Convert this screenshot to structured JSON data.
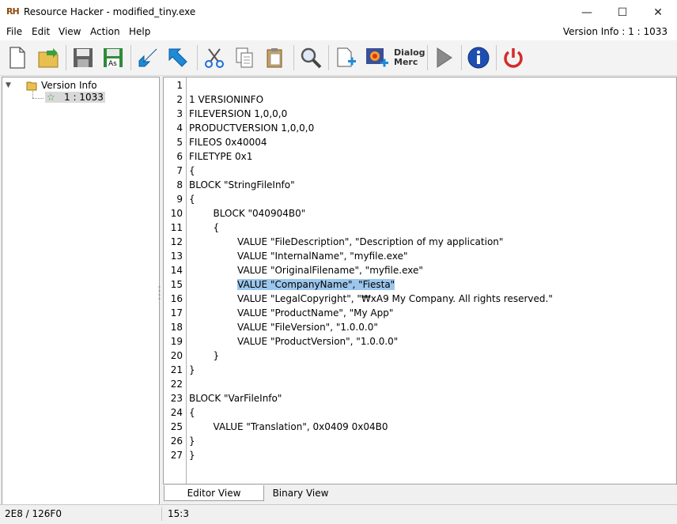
{
  "window": {
    "title": "Resource Hacker - modified_tiny.exe",
    "logo_text": "RH",
    "minimize_glyph": "—",
    "maximize_glyph": "☐",
    "close_glyph": "✕"
  },
  "menu": {
    "items": [
      "File",
      "Edit",
      "View",
      "Action",
      "Help"
    ],
    "right_label": "Version Info : 1 : 1033"
  },
  "toolbar": {
    "dialog_menu_line1": "Dialog",
    "dialog_menu_line2": "Merc"
  },
  "tree": {
    "root_label": "Version Info",
    "child_label": "1 : 1033"
  },
  "editor": {
    "lines": [
      "",
      "1 VERSIONINFO",
      "FILEVERSION 1,0,0,0",
      "PRODUCTVERSION 1,0,0,0",
      "FILEOS 0x40004",
      "FILETYPE 0x1",
      "{",
      "BLOCK \"StringFileInfo\"",
      "{",
      "        BLOCK \"040904B0\"",
      "        {",
      "                VALUE \"FileDescription\", \"Description of my application\"",
      "                VALUE \"InternalName\", \"myfile.exe\"",
      "                VALUE \"OriginalFilename\", \"myfile.exe\"",
      "                VALUE \"CompanyName\", \"Fiesta\"",
      "                VALUE \"LegalCopyright\", \"₩xA9 My Company. All rights reserved.\"",
      "                VALUE \"ProductName\", \"My App\"",
      "                VALUE \"FileVersion\", \"1.0.0.0\"",
      "                VALUE \"ProductVersion\", \"1.0.0.0\"",
      "        }",
      "}",
      "",
      "BLOCK \"VarFileInfo\"",
      "{",
      "        VALUE \"Translation\", 0x0409 0x04B0",
      "}",
      "}"
    ],
    "line_numbers": [
      "1",
      "2",
      "3",
      "4",
      "5",
      "6",
      "7",
      "8",
      "9",
      "10",
      "11",
      "12",
      "13",
      "14",
      "15",
      "16",
      "17",
      "18",
      "19",
      "20",
      "21",
      "22",
      "23",
      "24",
      "25",
      "26",
      "27"
    ],
    "highlighted_line": 15,
    "highlight_color": "#9cc6ec"
  },
  "tabs": {
    "editor_view": "Editor View",
    "binary_view": "Binary View"
  },
  "status": {
    "left": "2E8 / 126F0",
    "right": "15:3"
  },
  "colors": {
    "accent_blue": "#1e7fd8",
    "power_red": "#d42b2b",
    "folder_yellow": "#e8c050"
  },
  "icons": {
    "toolbar": [
      "new-file-icon",
      "open-file-icon",
      "save-icon",
      "save-as-icon",
      "import-icon",
      "export-icon",
      "cut-icon",
      "copy-icon",
      "paste-icon",
      "find-icon",
      "add-resource-icon",
      "add-image-icon",
      "dialog-menu-icon",
      "compile-run-icon",
      "about-icon",
      "exit-icon"
    ]
  }
}
